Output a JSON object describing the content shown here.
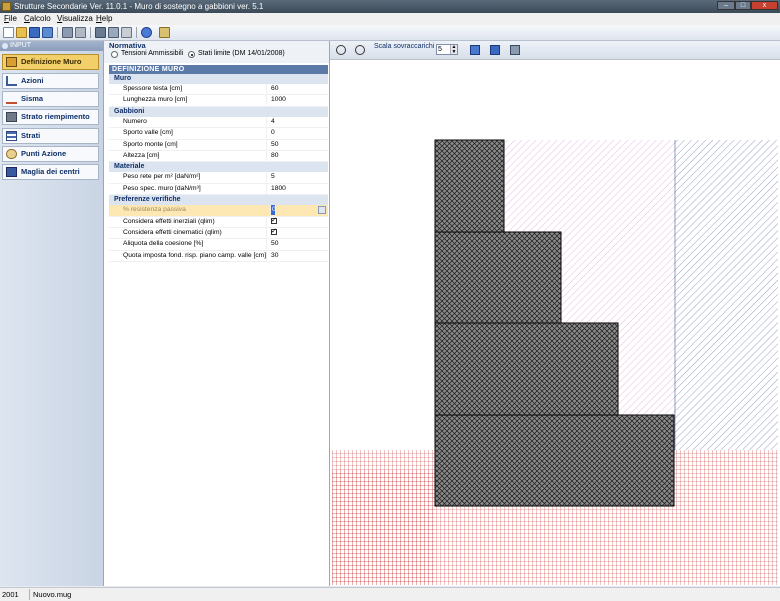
{
  "window": {
    "title": "Strutture Secondarie Ver. 11.0.1 - Muro di sostegno a gabbioni ver. 5.1",
    "minimize": "–",
    "maximize": "□",
    "close": "x"
  },
  "menu": [
    {
      "id": "file",
      "accel": "F",
      "rest": "ile"
    },
    {
      "id": "calcolo",
      "accel": "C",
      "rest": "alcolo"
    },
    {
      "id": "visualizza",
      "accel": "V",
      "rest": "isualizza"
    },
    {
      "id": "help",
      "accel": "H",
      "rest": "elp"
    }
  ],
  "nav": {
    "header": "INPUT",
    "items": [
      {
        "label": "Definizione Muro",
        "icon": "wall-icon",
        "active": true
      },
      {
        "label": "Azioni",
        "icon": "loads-icon",
        "active": false
      },
      {
        "label": "Sisma",
        "icon": "seismic-icon",
        "active": false
      },
      {
        "label": "Strato riempimento",
        "icon": "backfill-icon",
        "active": false
      },
      {
        "label": "Strati",
        "icon": "layers-icon",
        "active": false
      },
      {
        "label": "Punti Azione",
        "icon": "action-points-icon",
        "active": false
      },
      {
        "label": "Maglia dei centri",
        "icon": "centers-grid-icon",
        "active": false
      }
    ]
  },
  "normativa": {
    "label": "Normativa",
    "options": [
      {
        "label": "Tensioni Ammissibili",
        "selected": false
      },
      {
        "label": "Stati limite (DM 14/01/2008)",
        "selected": true
      }
    ]
  },
  "grid": {
    "section": "DEFINIZIONE MURO",
    "groups": [
      {
        "name": "Muro",
        "rows": [
          {
            "key": "Spessore testa [cm]",
            "value": "60"
          },
          {
            "key": "Lunghezza muro [cm]",
            "value": "1000"
          }
        ]
      },
      {
        "name": "Gabbioni",
        "rows": [
          {
            "key": "Numero",
            "value": "4"
          },
          {
            "key": "Sporto valle [cm]",
            "value": "0"
          },
          {
            "key": "Sporto monte [cm]",
            "value": "50"
          },
          {
            "key": "Altezza [cm]",
            "value": "80"
          }
        ]
      },
      {
        "name": "Materiale",
        "rows": [
          {
            "key": "Peso rete per m² [daN/m²]",
            "value": "5"
          },
          {
            "key": "Peso spec. muro [daN/m³]",
            "value": "1800"
          }
        ]
      },
      {
        "name": "Preferenze verifiche",
        "rows": [
          {
            "key": "% resistenza passiva",
            "value": "0",
            "selected": true
          },
          {
            "key": "Considera effetti inerziali (qlim)",
            "check": true
          },
          {
            "key": "Considera effetti cinematici (qlim)",
            "check": true
          },
          {
            "key": "Aliquota della coesione [%]",
            "value": "50"
          },
          {
            "key": "Quota imposta fond. risp. piano camp. valle [cm]",
            "value": "30"
          }
        ]
      }
    ]
  },
  "drawing": {
    "scale_label": "Scala sovraccarichi",
    "scale_value": "5",
    "colors": {
      "gabion": "#808080",
      "backfill": "#d88cd0",
      "soil": "#c83a3a",
      "right_soil": "#5060a0"
    }
  },
  "status": {
    "left": "2001",
    "file": "Nuovo.mug"
  }
}
